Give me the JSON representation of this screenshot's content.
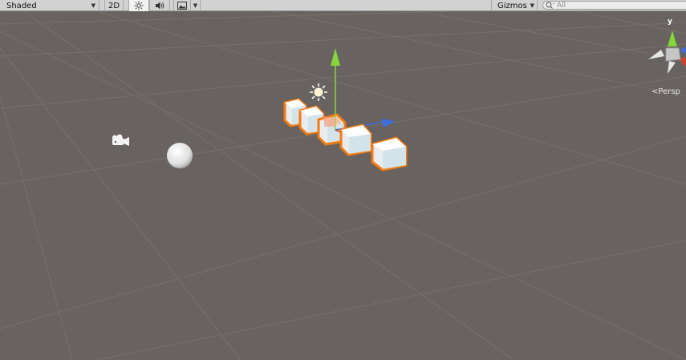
{
  "toolbar": {
    "draw_mode": "Shaded",
    "mode_2d": "2D",
    "gizmos_label": "Gizmos",
    "search_placeholder": "All"
  },
  "viewport": {
    "projection_label": "Persp",
    "axis_y_label": "y"
  },
  "colors": {
    "background": "#686360",
    "selection_outline": "#f47a10",
    "axis_y": "#84d63b",
    "axis_x": "#d7412a",
    "axis_z": "#3c6fe0"
  },
  "icons": [
    "sun-icon",
    "speaker-icon",
    "image-icon",
    "camera-icon",
    "light-icon",
    "search-icon"
  ]
}
